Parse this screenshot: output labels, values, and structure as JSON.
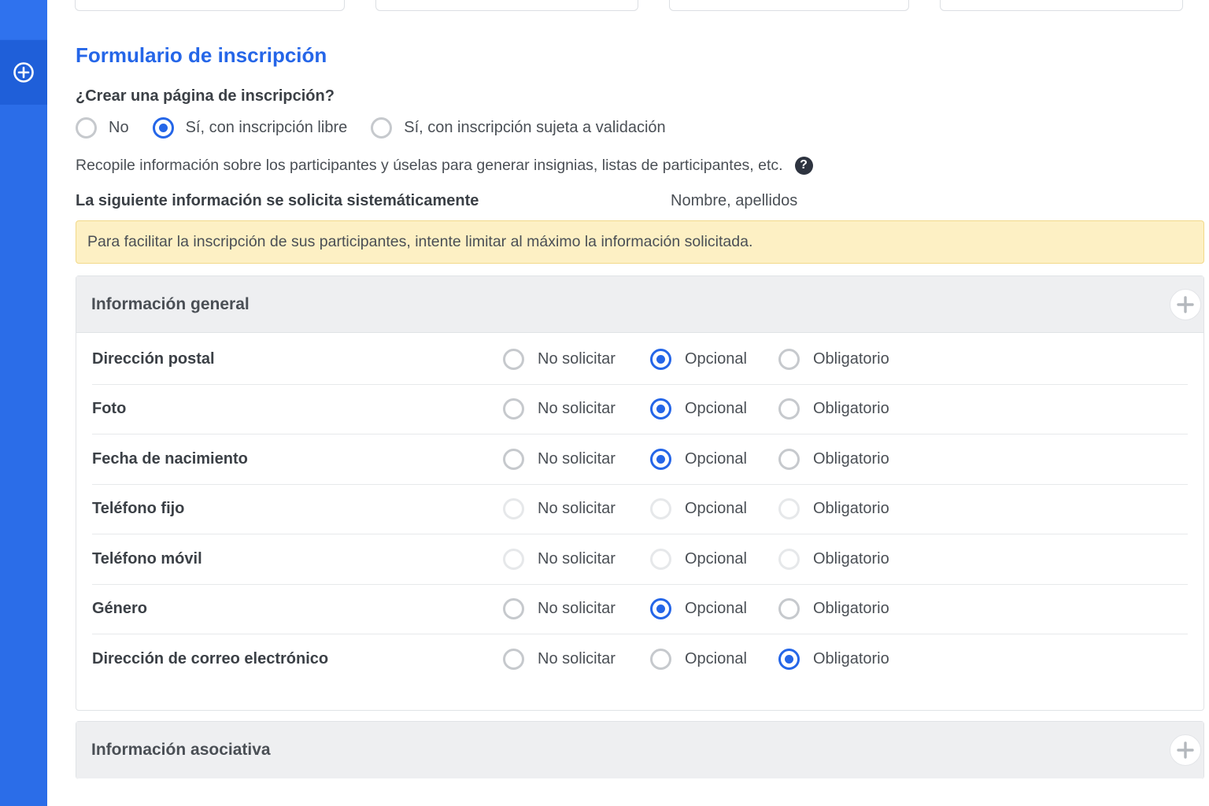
{
  "sidebar": {
    "add_icon": "circle-plus-icon"
  },
  "form": {
    "title": "Formulario de inscripción",
    "question": "¿Crear una página de inscripción?",
    "options": [
      {
        "label": "No",
        "selected": false
      },
      {
        "label": "Sí, con inscripción libre",
        "selected": true
      },
      {
        "label": "Sí, con inscripción sujeta a validación",
        "selected": false
      }
    ],
    "description": "Recopile información sobre los participantes y úselas para generar insignias, listas de participantes, etc.",
    "help_icon": "question-circle-icon",
    "help_glyph": "?",
    "systematic_label": "La siguiente información se solicita sistemáticamente",
    "systematic_value": "Nombre, apellidos",
    "notice": "Para facilitar la inscripción de sus participantes, intente limitar al máximo la información solicitada."
  },
  "choice_labels": {
    "no": "No solicitar",
    "optional": "Opcional",
    "required": "Obligatorio"
  },
  "general": {
    "title": "Información general",
    "expand_icon": "plus-icon",
    "fields": [
      {
        "label": "Dirección postal",
        "value": "optional",
        "disabled": false
      },
      {
        "label": "Foto",
        "value": "optional",
        "disabled": false
      },
      {
        "label": "Fecha de nacimiento",
        "value": "optional",
        "disabled": false
      },
      {
        "label": "Teléfono fijo",
        "value": null,
        "disabled": true
      },
      {
        "label": "Teléfono móvil",
        "value": null,
        "disabled": true
      },
      {
        "label": "Género",
        "value": "optional",
        "disabled": false
      },
      {
        "label": "Dirección de correo electrónico",
        "value": "required",
        "disabled": false
      }
    ]
  },
  "associative": {
    "title": "Información asociativa",
    "expand_icon": "plus-icon"
  },
  "colors": {
    "accent": "#2566e8",
    "sidebar": "#2b6de8",
    "notice_bg": "#fdf0c4",
    "panel_head_bg": "#eeeff1"
  }
}
